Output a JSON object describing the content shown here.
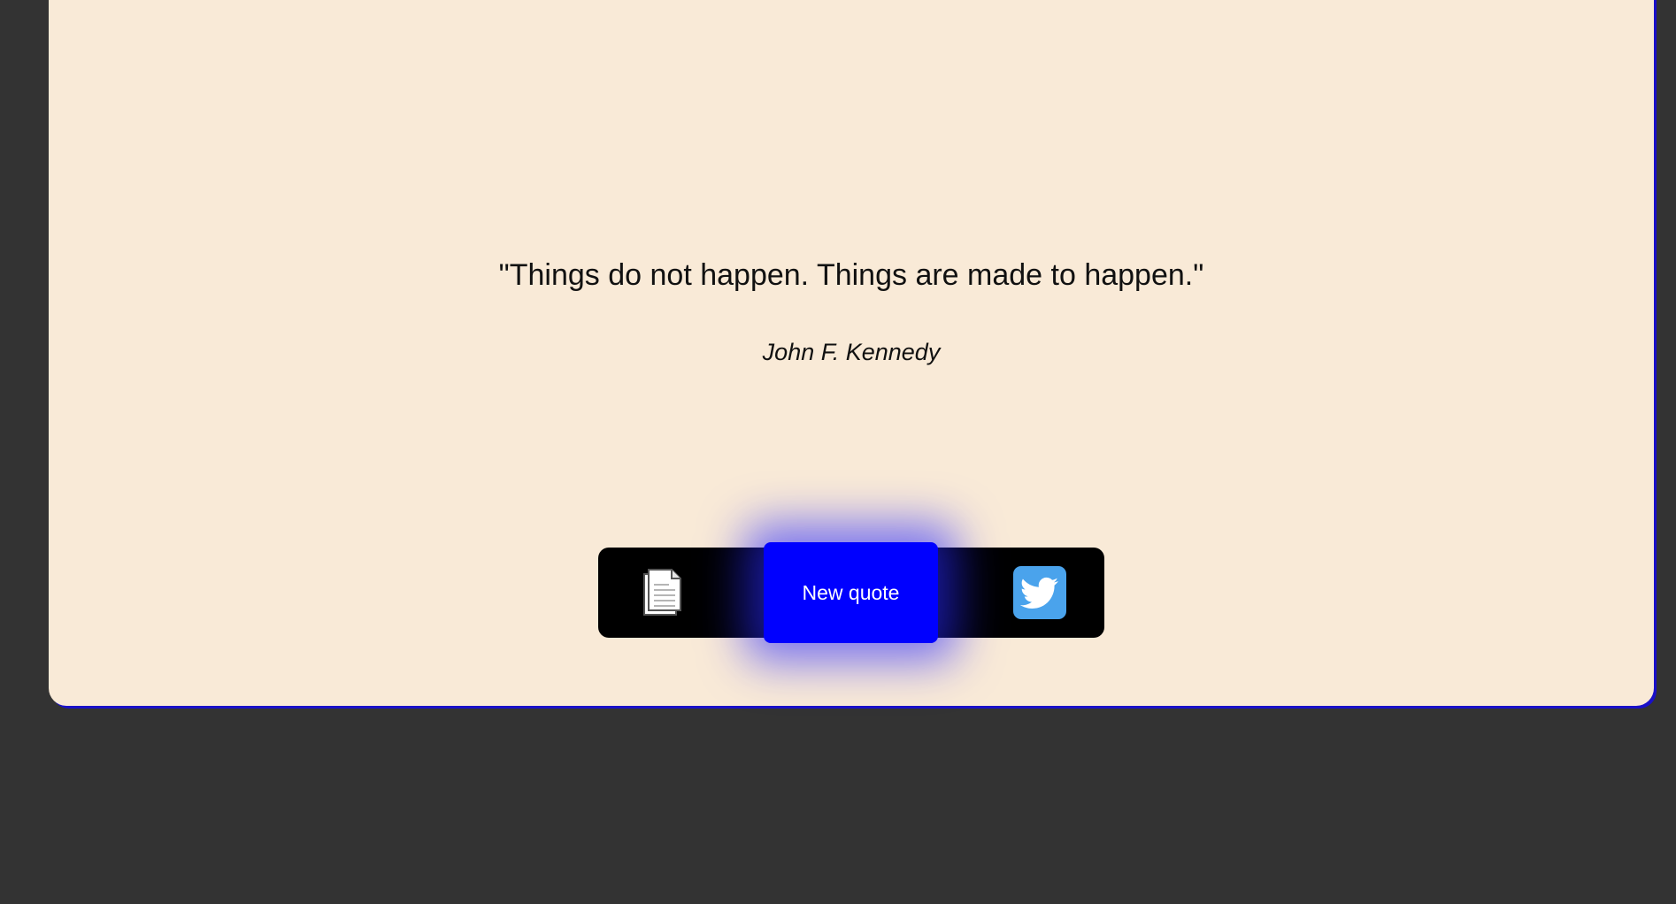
{
  "quote": {
    "text": "\"Things do not happen. Things are made to happen.\"",
    "author": "John F. Kennedy"
  },
  "actions": {
    "copy_icon": "document-copy-icon",
    "new_quote_label": "New quote",
    "share_icon": "twitter-icon"
  },
  "colors": {
    "background": "#333333",
    "card": "#F9EAD7",
    "accent": "#0000FF",
    "twitter": "#4AA3EC"
  }
}
